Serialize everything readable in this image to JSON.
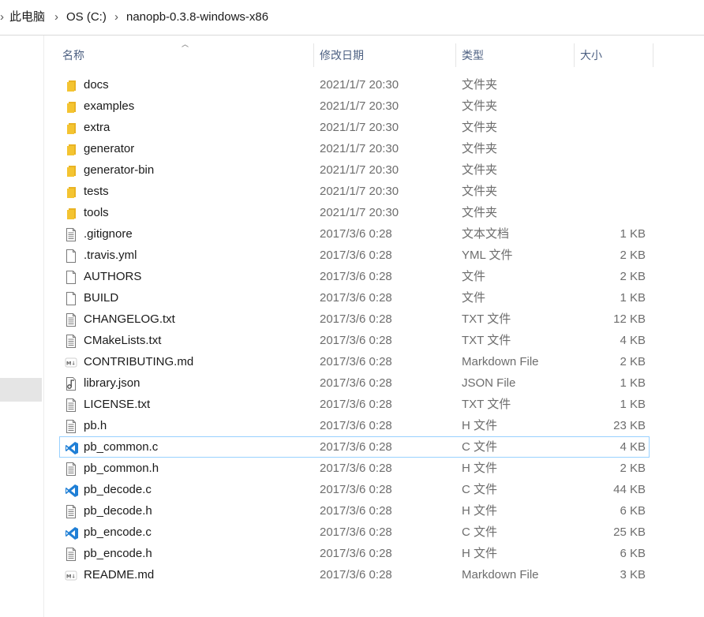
{
  "breadcrumb": {
    "items": [
      "此电脑",
      "OS (C:)",
      "nanopb-0.3.8-windows-x86"
    ],
    "separator": "›"
  },
  "columns": {
    "name": "名称",
    "date": "修改日期",
    "type": "类型",
    "size": "大小"
  },
  "colors": {
    "folder": "#f4c431",
    "vscode": "#1f7fd6",
    "selection_border": "#99d1ff",
    "header_text": "#4d6082"
  },
  "files": [
    {
      "name": "docs",
      "date": "2021/1/7 20:30",
      "type": "文件夹",
      "size": "",
      "icon": "folder-icon"
    },
    {
      "name": "examples",
      "date": "2021/1/7 20:30",
      "type": "文件夹",
      "size": "",
      "icon": "folder-icon"
    },
    {
      "name": "extra",
      "date": "2021/1/7 20:30",
      "type": "文件夹",
      "size": "",
      "icon": "folder-icon"
    },
    {
      "name": "generator",
      "date": "2021/1/7 20:30",
      "type": "文件夹",
      "size": "",
      "icon": "folder-icon"
    },
    {
      "name": "generator-bin",
      "date": "2021/1/7 20:30",
      "type": "文件夹",
      "size": "",
      "icon": "folder-icon"
    },
    {
      "name": "tests",
      "date": "2021/1/7 20:30",
      "type": "文件夹",
      "size": "",
      "icon": "folder-icon"
    },
    {
      "name": "tools",
      "date": "2021/1/7 20:30",
      "type": "文件夹",
      "size": "",
      "icon": "folder-icon"
    },
    {
      "name": ".gitignore",
      "date": "2017/3/6 0:28",
      "type": "文本文档",
      "size": "1 KB",
      "icon": "text-file-icon"
    },
    {
      "name": ".travis.yml",
      "date": "2017/3/6 0:28",
      "type": "YML 文件",
      "size": "2 KB",
      "icon": "blank-file-icon"
    },
    {
      "name": "AUTHORS",
      "date": "2017/3/6 0:28",
      "type": "文件",
      "size": "2 KB",
      "icon": "blank-file-icon"
    },
    {
      "name": "BUILD",
      "date": "2017/3/6 0:28",
      "type": "文件",
      "size": "1 KB",
      "icon": "blank-file-icon"
    },
    {
      "name": "CHANGELOG.txt",
      "date": "2017/3/6 0:28",
      "type": "TXT 文件",
      "size": "12 KB",
      "icon": "text-file-icon"
    },
    {
      "name": "CMakeLists.txt",
      "date": "2017/3/6 0:28",
      "type": "TXT 文件",
      "size": "4 KB",
      "icon": "text-file-icon"
    },
    {
      "name": "CONTRIBUTING.md",
      "date": "2017/3/6 0:28",
      "type": "Markdown File",
      "size": "2 KB",
      "icon": "markdown-file-icon"
    },
    {
      "name": "library.json",
      "date": "2017/3/6 0:28",
      "type": "JSON File",
      "size": "1 KB",
      "icon": "json-file-icon"
    },
    {
      "name": "LICENSE.txt",
      "date": "2017/3/6 0:28",
      "type": "TXT 文件",
      "size": "1 KB",
      "icon": "text-file-icon"
    },
    {
      "name": "pb.h",
      "date": "2017/3/6 0:28",
      "type": "H 文件",
      "size": "23 KB",
      "icon": "text-file-icon"
    },
    {
      "name": "pb_common.c",
      "date": "2017/3/6 0:28",
      "type": "C 文件",
      "size": "4 KB",
      "icon": "vscode-icon",
      "selected": true
    },
    {
      "name": "pb_common.h",
      "date": "2017/3/6 0:28",
      "type": "H 文件",
      "size": "2 KB",
      "icon": "text-file-icon"
    },
    {
      "name": "pb_decode.c",
      "date": "2017/3/6 0:28",
      "type": "C 文件",
      "size": "44 KB",
      "icon": "vscode-icon"
    },
    {
      "name": "pb_decode.h",
      "date": "2017/3/6 0:28",
      "type": "H 文件",
      "size": "6 KB",
      "icon": "text-file-icon"
    },
    {
      "name": "pb_encode.c",
      "date": "2017/3/6 0:28",
      "type": "C 文件",
      "size": "25 KB",
      "icon": "vscode-icon"
    },
    {
      "name": "pb_encode.h",
      "date": "2017/3/6 0:28",
      "type": "H 文件",
      "size": "6 KB",
      "icon": "text-file-icon"
    },
    {
      "name": "README.md",
      "date": "2017/3/6 0:28",
      "type": "Markdown File",
      "size": "3 KB",
      "icon": "markdown-file-icon"
    }
  ]
}
